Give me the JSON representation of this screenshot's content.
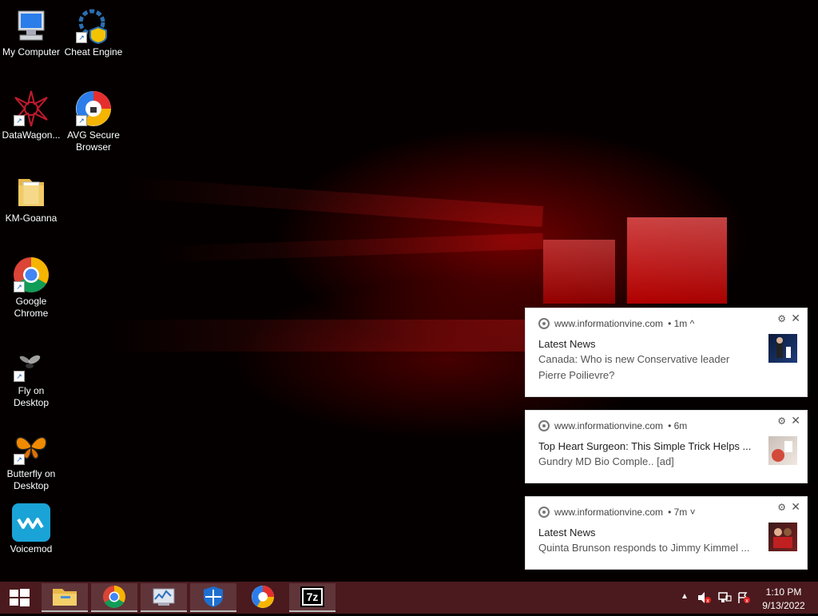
{
  "desktop": {
    "icons": [
      {
        "label": "My Computer"
      },
      {
        "label": "Cheat Engine"
      },
      {
        "label": "DataWagon..."
      },
      {
        "label": "AVG Secure Browser"
      },
      {
        "label": "KM-Goanna"
      },
      {
        "label": "Google Chrome"
      },
      {
        "label": "Fly on Desktop"
      },
      {
        "label": "Butterfly on Desktop"
      },
      {
        "label": "Voicemod"
      }
    ]
  },
  "notifications": [
    {
      "site": "www.informationvine.com",
      "time": "• 1m ^",
      "title": "Latest News",
      "body": "Canada: Who is new Conservative leader Pierre Poilievre?"
    },
    {
      "site": "www.informationvine.com",
      "time": "• 6m",
      "title": "Top Heart Surgeon: This Simple Trick Helps ...",
      "body": "Gundry MD Bio Comple.. [ad]"
    },
    {
      "site": "www.informationvine.com",
      "time": "• 7m ˅",
      "title": "Latest News",
      "body": "Quinta Brunson responds to Jimmy Kimmel ..."
    }
  ],
  "taskbar": {
    "apps": [
      "start-button",
      "file-explorer",
      "google-chrome",
      "task-manager",
      "windows-defender",
      "avg-secure-browser",
      "7-zip"
    ],
    "tray": {
      "time": "1:10 PM",
      "date": "9/13/2022"
    }
  },
  "colors": {
    "taskbar": "#4a1a1e",
    "wallpaper_accent": "#e00000"
  }
}
